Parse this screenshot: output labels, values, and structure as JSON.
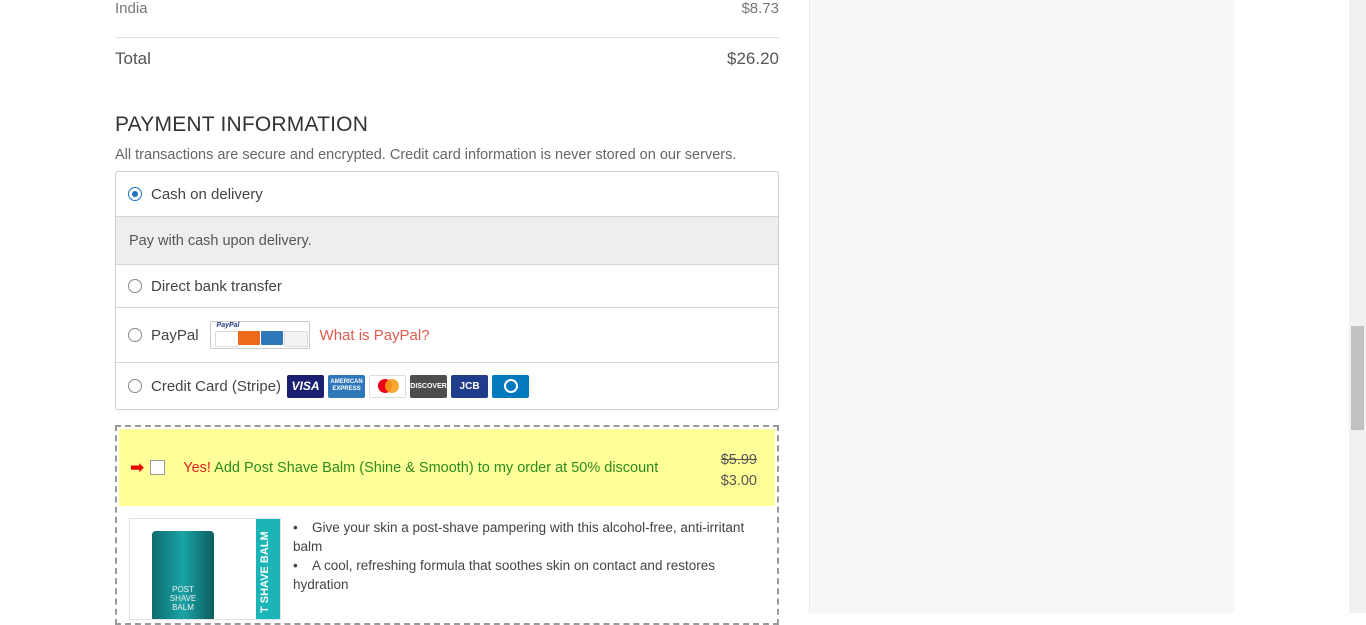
{
  "summary": {
    "country_label": "India",
    "country_amount": "$8.73",
    "total_label": "Total",
    "total_amount": "$26.20"
  },
  "payment": {
    "title": "PAYMENT INFORMATION",
    "description": "All transactions are secure and encrypted. Credit card information is never stored on our servers.",
    "methods": [
      {
        "label": "Cash on delivery",
        "selected": true,
        "description": "Pay with cash upon delivery."
      },
      {
        "label": "Direct bank transfer",
        "selected": false
      },
      {
        "label": "PayPal",
        "selected": false,
        "link": "What is PayPal?",
        "logo_text": "PayPal"
      },
      {
        "label": "Credit Card (Stripe)",
        "selected": false
      }
    ],
    "card_brands": [
      "VISA",
      "AMERICAN EXPRESS",
      "mastercard",
      "DISCOVER",
      "JCB",
      "diners-club"
    ]
  },
  "offer": {
    "yes": "Yes!",
    "text": "Add Post Shave Balm (Shine & Smooth) to my order at 50% discount",
    "old_price": "$5.99",
    "new_price": "$3.00",
    "product_label": "POST SHAVE BALM",
    "side_label": "T SHAVE BALM",
    "bullets": [
      "Give your skin a post-shave pampering with this alcohol-free, anti-irritant balm",
      "A cool, refreshing formula that soothes skin on contact and restores hydration"
    ]
  },
  "colors": {
    "radio_selected": "#1e73be",
    "link": "#e15b4d",
    "offer_bg": "#ffff99",
    "offer_text": "#2e8b1f",
    "offer_yes": "#dd2222"
  }
}
